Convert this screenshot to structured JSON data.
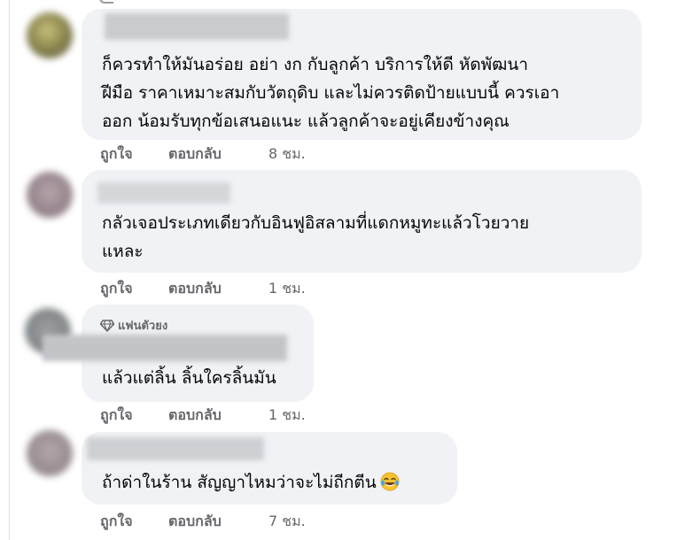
{
  "comments": [
    {
      "lines": [
        "ก็ควรทำให้มันอร่อย อย่า งก กับลูกค้า บริการให้ดี หัดพัฒนา",
        "ฝีมือ ราคาเหมาะสมกับวัตถุดิบ และไม่ควรติดป้ายแบบนี้ ควรเอา",
        "ออก น้อมรับทุกข้อเสนอแนะ แล้วลูกค้าจะอยู่เคียงข้างคุณ"
      ],
      "like_label": "ถูกใจ",
      "reply_label": "ตอบกลับ",
      "time": "8 ชม."
    },
    {
      "lines": [
        "กลัวเจอประเภทเดียวกับอินฟูอิสลามที่แดกหมูทะแล้วโวยวาย",
        "แหละ"
      ],
      "like_label": "ถูกใจ",
      "reply_label": "ตอบกลับ",
      "time": "1 ชม."
    },
    {
      "badge": "แฟนตัวยง",
      "badge_icon": "diamond-icon",
      "lines": [
        "แล้วแต่ลิ้น ลิ้นใครลิ้นมัน"
      ],
      "like_label": "ถูกใจ",
      "reply_label": "ตอบกลับ",
      "time": "1 ชม."
    },
    {
      "lines": [
        "ถ้าด่าในร้าน สัญญาไหมว่าจะไม่ถีกตีน"
      ],
      "emoji": "laughing-tears-emoji",
      "like_label": "ถูกใจ",
      "reply_label": "ตอบกลับ",
      "time": "7 ชม."
    }
  ],
  "colors": {
    "bubble": "#f0f2f5",
    "text": "#050505",
    "meta": "#65676b"
  }
}
